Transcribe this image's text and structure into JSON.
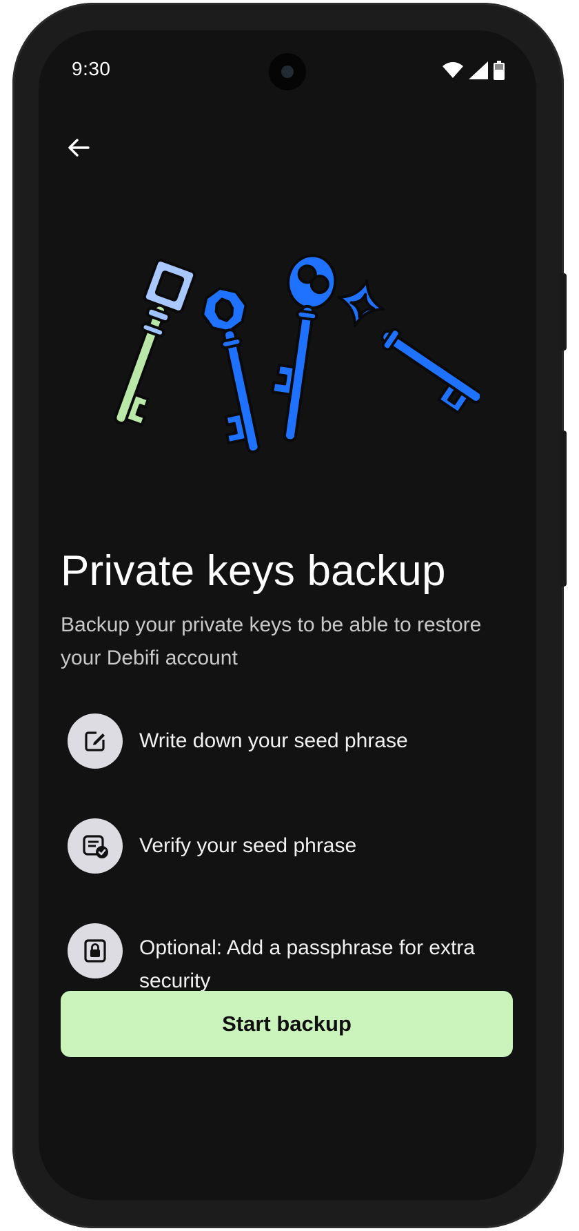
{
  "status_bar": {
    "time": "9:30",
    "icons": [
      "wifi-icon",
      "cellular-signal-icon",
      "battery-icon"
    ]
  },
  "header": {
    "back_icon": "arrow-left-icon"
  },
  "hero": {
    "illustration": "keys-illustration",
    "colors": {
      "key_blue": "#1f72ff",
      "key_light": "#9ec3ff",
      "key_green": "#c8f5a8"
    }
  },
  "main": {
    "title": "Private keys backup",
    "subtitle": "Backup your private keys to be able to restore your Debifi account",
    "steps": [
      {
        "icon": "edit-icon",
        "label": "Write down your seed phrase"
      },
      {
        "icon": "document-check-icon",
        "label": "Verify your seed phrase"
      },
      {
        "icon": "lock-icon",
        "label": "Optional: Add a passphrase for extra security"
      }
    ]
  },
  "actions": {
    "start_label": "Start backup"
  },
  "colors": {
    "background": "#121212",
    "accent": "#caf4bb",
    "icon_circle": "#dcdce2"
  }
}
